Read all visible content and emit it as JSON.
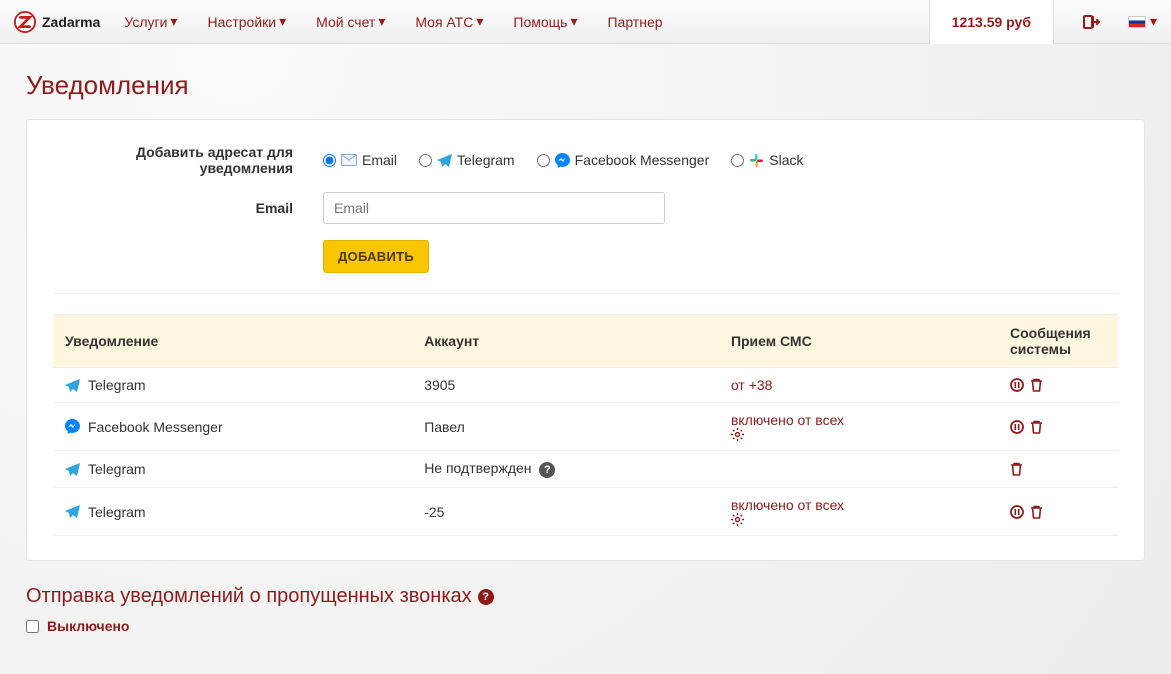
{
  "brand": "Zadarma",
  "nav": {
    "items": [
      "Услуги",
      "Настройки",
      "Мой счет",
      "Моя АТС",
      "Помощь"
    ],
    "partner": "Партнер"
  },
  "balance": "1213.59 руб",
  "page": {
    "title": "Уведомления"
  },
  "form": {
    "add_label": "Добавить адресат для уведомления",
    "channels": {
      "email": "Email",
      "telegram": "Telegram",
      "fb": "Facebook Messenger",
      "slack": "Slack"
    },
    "email_label": "Email",
    "email_placeholder": "Email",
    "add_btn": "ДОБАВИТЬ"
  },
  "table": {
    "headers": {
      "notif": "Уведомление",
      "account": "Аккаунт",
      "sms": "Прием СМС",
      "sysmsg": "Сообщения системы"
    },
    "rows": [
      {
        "service": "Telegram",
        "service_icon": "telegram",
        "account": "3905",
        "sms": "от +38",
        "sms_gear": false,
        "has_pause": true,
        "has_delete": true,
        "help": false
      },
      {
        "service": "Facebook Messenger",
        "service_icon": "fb",
        "account": "Павел",
        "sms": "включено от всех",
        "sms_gear": true,
        "has_pause": true,
        "has_delete": true,
        "help": false
      },
      {
        "service": "Telegram",
        "service_icon": "telegram",
        "account": "Не подтвержден",
        "sms": "",
        "sms_gear": false,
        "has_pause": false,
        "has_delete": true,
        "help": true
      },
      {
        "service": "Telegram",
        "service_icon": "telegram",
        "account": "-25",
        "sms": "включено от всех",
        "sms_gear": true,
        "has_pause": true,
        "has_delete": true,
        "help": false
      }
    ]
  },
  "missed": {
    "title": "Отправка уведомлений о пропущенных звонках",
    "state": "Выключено"
  }
}
